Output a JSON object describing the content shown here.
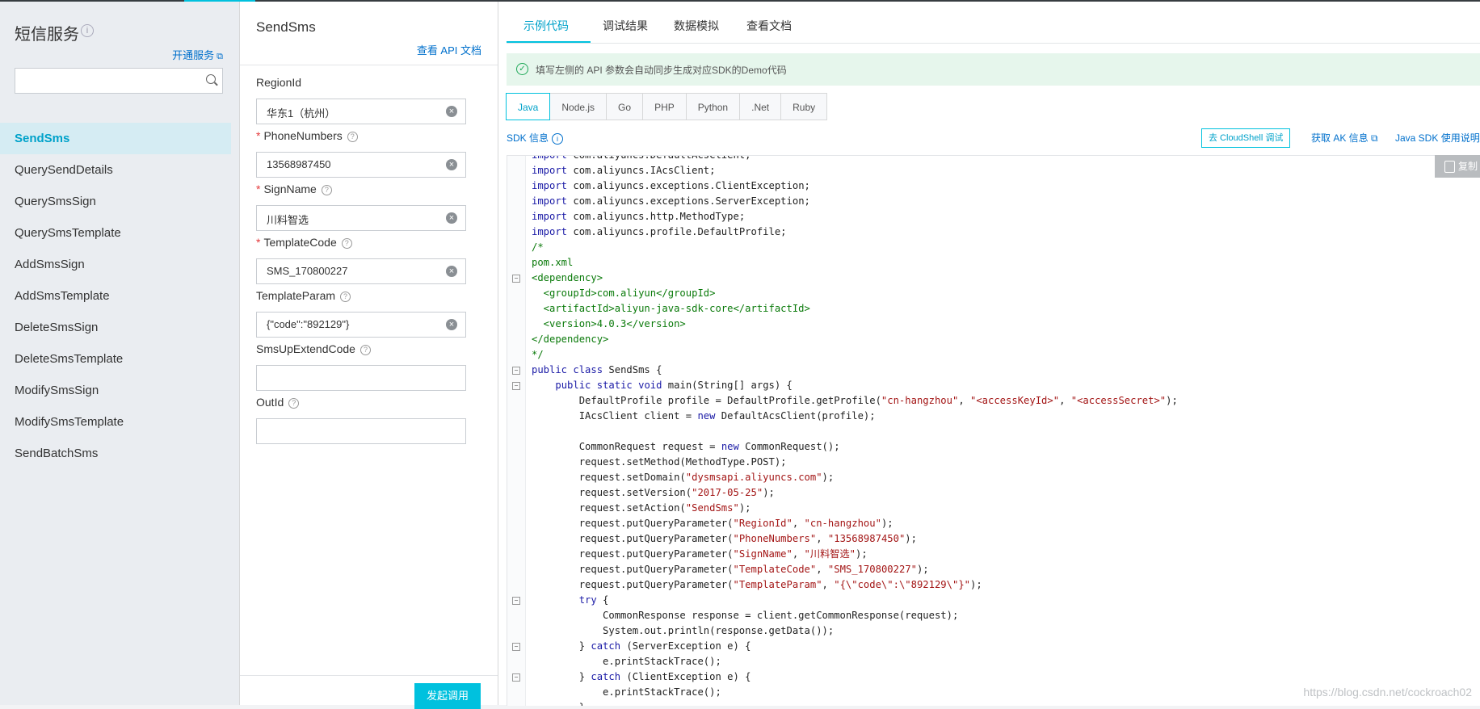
{
  "sidebar": {
    "title": "短信服务",
    "open_service": "开通服务",
    "search_placeholder": "",
    "items": [
      {
        "label": "SendSms",
        "active": true
      },
      {
        "label": "QuerySendDetails"
      },
      {
        "label": "QuerySmsSign"
      },
      {
        "label": "QuerySmsTemplate"
      },
      {
        "label": "AddSmsSign"
      },
      {
        "label": "AddSmsTemplate"
      },
      {
        "label": "DeleteSmsSign"
      },
      {
        "label": "DeleteSmsTemplate"
      },
      {
        "label": "ModifySmsSign"
      },
      {
        "label": "ModifySmsTemplate"
      },
      {
        "label": "SendBatchSms"
      }
    ]
  },
  "form": {
    "title": "SendSms",
    "api_doc_link": "查看 API 文档",
    "fields": [
      {
        "label": "RegionId",
        "required": false,
        "value": "华东1（杭州）"
      },
      {
        "label": "PhoneNumbers",
        "required": true,
        "value": "13568987450"
      },
      {
        "label": "SignName",
        "required": true,
        "value": "川料智选"
      },
      {
        "label": "TemplateCode",
        "required": true,
        "value": "SMS_170800227"
      },
      {
        "label": "TemplateParam",
        "required": false,
        "value": "{\"code\":\"892129\"}"
      },
      {
        "label": "SmsUpExtendCode",
        "required": false,
        "value": ""
      },
      {
        "label": "OutId",
        "required": false,
        "value": ""
      }
    ],
    "submit_label": "发起调用"
  },
  "tabs": [
    {
      "label": "示例代码",
      "active": true
    },
    {
      "label": "调试结果"
    },
    {
      "label": "数据模拟"
    },
    {
      "label": "查看文档"
    }
  ],
  "notice": "填写左侧的 API 参数会自动同步生成对应SDK的Demo代码",
  "languages": [
    {
      "label": "Java",
      "active": true
    },
    {
      "label": "Node.js"
    },
    {
      "label": "Go"
    },
    {
      "label": "PHP"
    },
    {
      "label": "Python"
    },
    {
      "label": ".Net"
    },
    {
      "label": "Ruby"
    }
  ],
  "toolbar": {
    "sdk_info": "SDK 信息",
    "cloudshell": "去 CloudShell 调试",
    "get_ak": "获取 AK 信息",
    "sdk_usage": "Java SDK 使用说明",
    "copy": "复制"
  },
  "code_lines": [
    {
      "text": "import com.aliyuncs.DefaultAcsClient;",
      "fold": false
    },
    {
      "text": "import com.aliyuncs.IAcsClient;",
      "fold": false
    },
    {
      "text": "import com.aliyuncs.exceptions.ClientException;",
      "fold": false
    },
    {
      "text": "import com.aliyuncs.exceptions.ServerException;",
      "fold": false
    },
    {
      "text": "import com.aliyuncs.http.MethodType;",
      "fold": false
    },
    {
      "text": "import com.aliyuncs.profile.DefaultProfile;",
      "fold": false
    },
    {
      "text": "/*",
      "fold": false
    },
    {
      "text": "pom.xml",
      "fold": false
    },
    {
      "text": "<dependency>",
      "fold": true
    },
    {
      "text": "  <groupId>com.aliyun</groupId>",
      "fold": false
    },
    {
      "text": "  <artifactId>aliyun-java-sdk-core</artifactId>",
      "fold": false
    },
    {
      "text": "  <version>4.0.3</version>",
      "fold": false
    },
    {
      "text": "</dependency>",
      "fold": false
    },
    {
      "text": "*/",
      "fold": false
    },
    {
      "text": "public class SendSms {",
      "fold": true
    },
    {
      "text": "    public static void main(String[] args) {",
      "fold": true
    },
    {
      "text": "        DefaultProfile profile = DefaultProfile.getProfile(\"cn-hangzhou\", \"<accessKeyId>\", \"<accessSecret>\");",
      "fold": false
    },
    {
      "text": "        IAcsClient client = new DefaultAcsClient(profile);",
      "fold": false
    },
    {
      "text": "",
      "fold": false
    },
    {
      "text": "        CommonRequest request = new CommonRequest();",
      "fold": false
    },
    {
      "text": "        request.setMethod(MethodType.POST);",
      "fold": false
    },
    {
      "text": "        request.setDomain(\"dysmsapi.aliyuncs.com\");",
      "fold": false
    },
    {
      "text": "        request.setVersion(\"2017-05-25\");",
      "fold": false
    },
    {
      "text": "        request.setAction(\"SendSms\");",
      "fold": false
    },
    {
      "text": "        request.putQueryParameter(\"RegionId\", \"cn-hangzhou\");",
      "fold": false
    },
    {
      "text": "        request.putQueryParameter(\"PhoneNumbers\", \"13568987450\");",
      "fold": false
    },
    {
      "text": "        request.putQueryParameter(\"SignName\", \"川料智选\");",
      "fold": false
    },
    {
      "text": "        request.putQueryParameter(\"TemplateCode\", \"SMS_170800227\");",
      "fold": false
    },
    {
      "text": "        request.putQueryParameter(\"TemplateParam\", \"{\\\"code\\\":\\\"892129\\\"}\");",
      "fold": false
    },
    {
      "text": "        try {",
      "fold": true
    },
    {
      "text": "            CommonResponse response = client.getCommonResponse(request);",
      "fold": false
    },
    {
      "text": "            System.out.println(response.getData());",
      "fold": false
    },
    {
      "text": "        } catch (ServerException e) {",
      "fold": true
    },
    {
      "text": "            e.printStackTrace();",
      "fold": false
    },
    {
      "text": "        } catch (ClientException e) {",
      "fold": true
    },
    {
      "text": "            e.printStackTrace();",
      "fold": false
    },
    {
      "text": "        }",
      "fold": false
    }
  ],
  "watermark": "https://blog.csdn.net/cockroach02",
  "colors": {
    "accent": "#00c1de",
    "link": "#0070cc",
    "active_nav_bg": "#d5ecf3",
    "required": "#e4393c"
  }
}
